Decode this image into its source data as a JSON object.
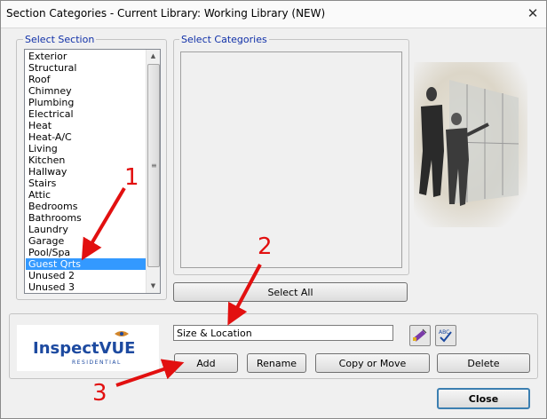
{
  "window": {
    "title": "Section Categories - Current Library: Working Library (NEW)",
    "close_glyph": "✕"
  },
  "select_section": {
    "label": "Select Section",
    "items": [
      "Exterior",
      "Structural",
      "Roof",
      "Chimney",
      "Plumbing",
      "Electrical",
      "Heat",
      "Heat-A/C",
      "Living",
      "Kitchen",
      "Hallway",
      "Stairs",
      "Attic",
      "Bedrooms",
      "Bathrooms",
      "Laundry",
      "Garage",
      "Pool/Spa",
      "Guest Qrts",
      "Unused 2",
      "Unused 3"
    ],
    "selected_index": 18
  },
  "select_categories": {
    "label": "Select Categories",
    "select_all_label": "Select All"
  },
  "category_input": {
    "value": "Size & Location"
  },
  "actions": {
    "add": "Add",
    "rename": "Rename",
    "copy_move": "Copy or Move",
    "delete": "Delete",
    "close": "Close"
  },
  "logo": {
    "text_main": "InspectVUE",
    "text_sub": "RESIDENTIAL",
    "brand_color": "#1d4aa0",
    "accent_color": "#d2862a"
  },
  "annotations": {
    "labels": [
      "1",
      "2",
      "3"
    ],
    "color": "#e21010"
  },
  "icons": [
    "spellcheck-pen-icon",
    "abc-check-icon",
    "close-icon",
    "scroll-up-arrow-icon",
    "scroll-down-arrow-icon"
  ]
}
